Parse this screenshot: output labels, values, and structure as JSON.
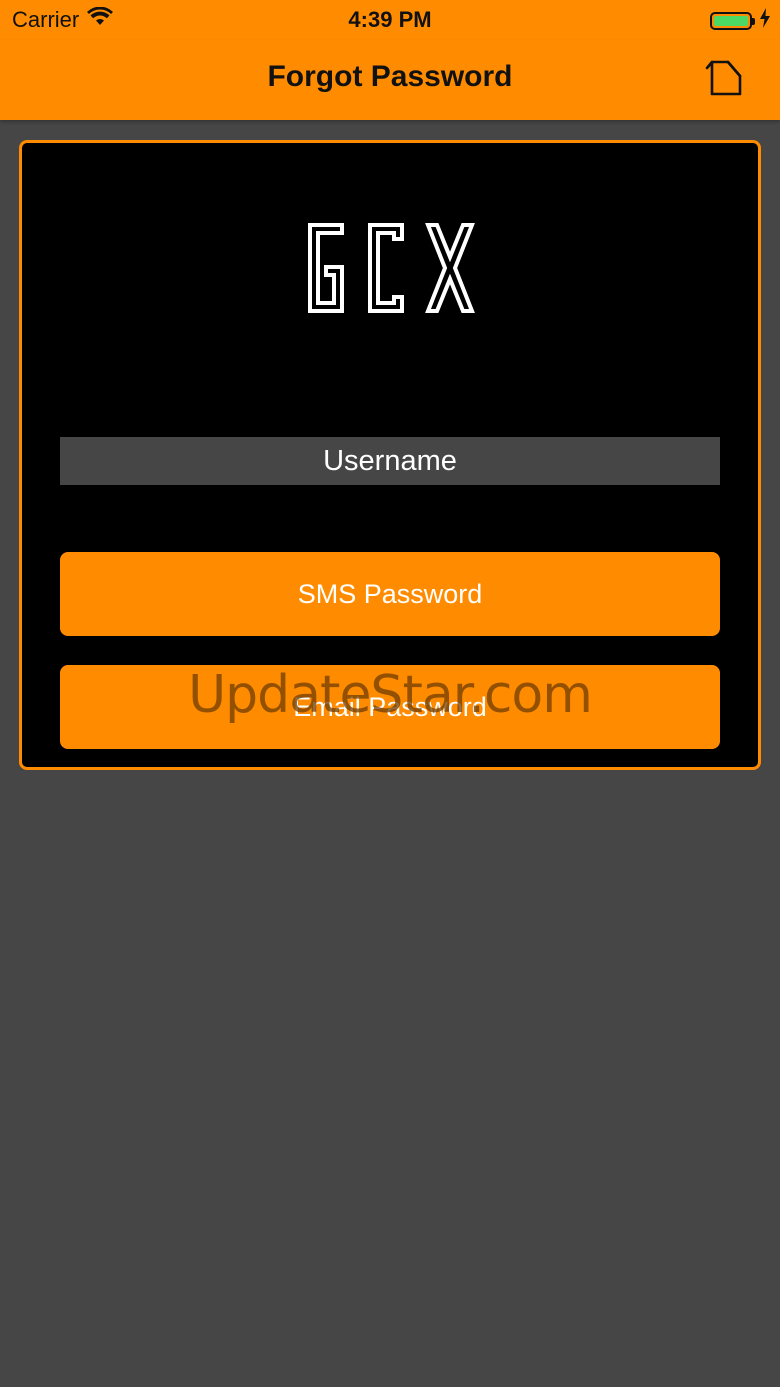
{
  "status_bar": {
    "carrier": "Carrier",
    "time": "4:39 PM",
    "battery_level": 1.0,
    "battery_color": "#4CD964",
    "icons": [
      "wifi-icon",
      "battery-icon",
      "charging-bolt-icon"
    ]
  },
  "nav": {
    "title": "Forgot Password",
    "home_icon": "home-icon"
  },
  "form": {
    "logo_text": "GCX",
    "username_placeholder": "Username",
    "username_value": "",
    "sms_button_label": "SMS Password",
    "email_button_label": "Email Password"
  },
  "watermark": {
    "text": "UpdateStar.com"
  },
  "colors": {
    "accent": "#FF8C00",
    "background": "#464646",
    "card": "#000000",
    "field": "#464646",
    "button_text": "#FFFFFF"
  }
}
